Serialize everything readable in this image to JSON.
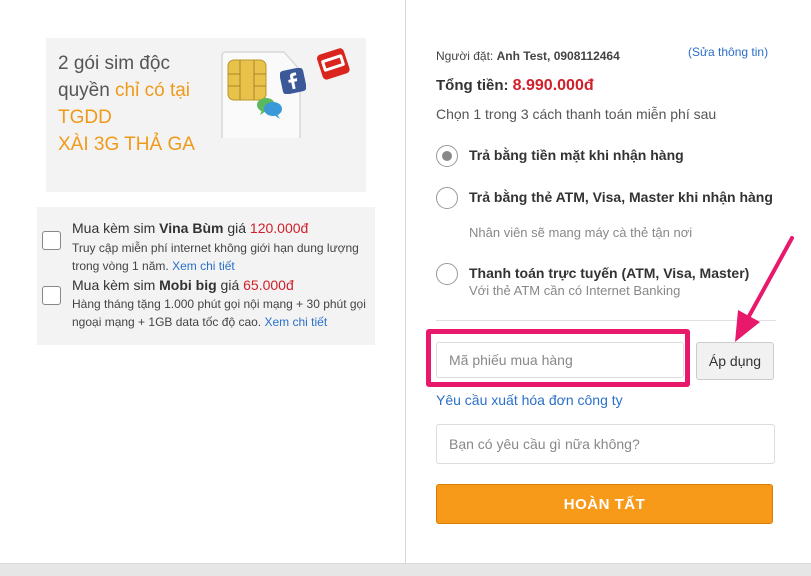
{
  "promo": {
    "line1": "2 gói sim độc quyền ",
    "highlight1": "chỉ có tại TGDD",
    "highlight2": "XÀI 3G THẢ GA",
    "icons": [
      "sim-card-icon",
      "youtube-icon",
      "facebook-icon",
      "chat-bubbles-icon"
    ]
  },
  "addons": [
    {
      "prefix": "Mua kèm sim ",
      "name": "Vina Bùm",
      "mid": " giá ",
      "price": "120.000đ",
      "desc": "Truy cập miễn phí internet không giới hạn dung lượng trong vòng 1 năm. ",
      "link": "Xem chi tiết"
    },
    {
      "prefix": "Mua kèm sim ",
      "name": "Mobi big",
      "mid": " giá ",
      "price": "65.000đ",
      "desc": "Hàng tháng tặng 1.000 phút gọi nội mạng + 30 phút gọi ngoại mạng + 1GB data tốc độ cao. ",
      "link": "Xem chi tiết"
    }
  ],
  "order": {
    "orderer_label": "Người đặt: ",
    "orderer_name": "Anh Test, 0908112464",
    "edit_link": "(Sửa thông tin)",
    "total_label": "Tổng tiền: ",
    "total_amount": "8.990.000đ",
    "choose_text": "Chọn 1 trong 3 cách thanh toán miễn phí sau"
  },
  "payment_options": [
    {
      "title": "Trả bằng tiền mặt khi nhận hàng",
      "sub": "",
      "selected": true
    },
    {
      "title": "Trả bằng thẻ ATM, Visa, Master khi nhận hàng",
      "sub": "Nhân viên sẽ mang máy cà thẻ tận nơi",
      "selected": false
    },
    {
      "title": "Thanh toán trực tuyến (ATM, Visa, Master)",
      "sub": "Với thẻ ATM cần có Internet Banking",
      "selected": false
    }
  ],
  "coupon": {
    "placeholder": "Mã phiếu mua hàng",
    "apply_label": "Áp dụng"
  },
  "invoice_link": "Yêu cầu xuất hóa đơn công ty",
  "note": {
    "placeholder": "Bạn có yêu cầu gì nữa không?"
  },
  "submit_label": "HOÀN TẤT",
  "colors": {
    "accent": "#f79a1a",
    "price": "#d0202a",
    "link": "#2a6fc9",
    "annotation": "#e8196b"
  }
}
